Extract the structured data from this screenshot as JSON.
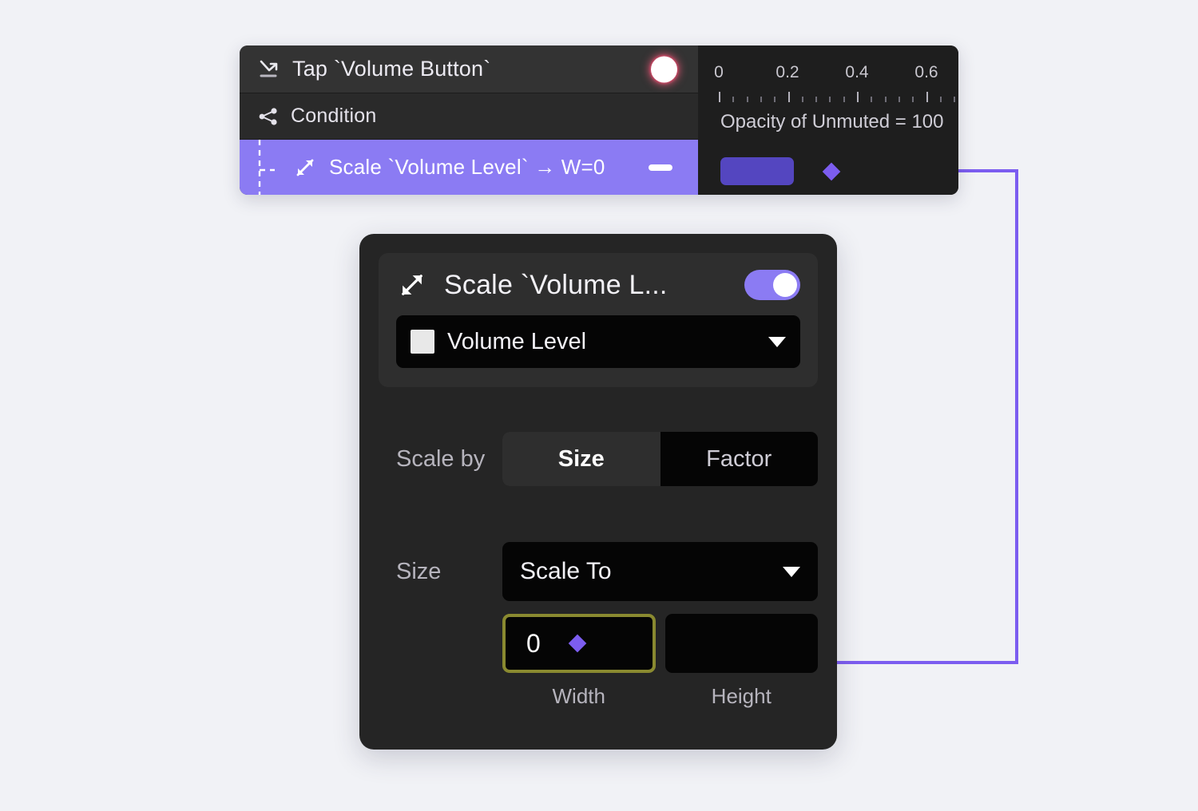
{
  "app": {
    "background_color": "#f1f2f6",
    "accent_purple": "#8b7bf3",
    "clip_purple": "#5446c0",
    "focus_outline": "#8a8a30"
  },
  "timeline": {
    "rows": [
      {
        "icon": "tap-gesture-icon",
        "label": "Tap `Volume Button`",
        "indicator": "record-dot",
        "selected": false
      },
      {
        "icon": "condition-branch-icon",
        "label": "Condition",
        "indicator": "none",
        "selected": false
      },
      {
        "icon": "scale-diagonal-arrow-icon",
        "label": "Scale `Volume Level` → W=0",
        "indicator": "minus-button",
        "selected": true
      }
    ],
    "ruler": {
      "tick_labels": [
        "0",
        "0.2",
        "0.4",
        "0.6"
      ],
      "minor_ticks_per_major": 5
    },
    "property_label": "Opacity of Unmuted = 100",
    "clip_block_name": "keyframe-clip"
  },
  "inspector": {
    "title": "Scale `Volume L...",
    "title_icon": "scale-diagonal-arrow-icon",
    "enabled_toggle": true,
    "layer_select": {
      "value": "Volume Level",
      "swatch_color": "#e8e8e8"
    },
    "scale_by": {
      "label": "Scale by",
      "options": [
        "Size",
        "Factor"
      ],
      "selected": "Size"
    },
    "size": {
      "label": "Size",
      "mode_value": "Scale To",
      "width": {
        "value": "0",
        "caption": "Width",
        "focused": true
      },
      "height": {
        "value": "",
        "caption": "Height",
        "focused": false
      }
    }
  },
  "connector": {
    "color": "#7c5df0",
    "from_node": "timeline-keyframe-node",
    "to_node": "width-field-node"
  }
}
